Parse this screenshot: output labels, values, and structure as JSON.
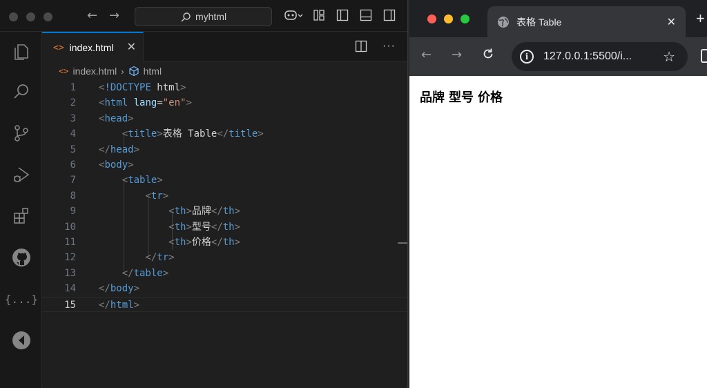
{
  "vscode": {
    "command_center": "myhtml",
    "tab": {
      "label": "index.html",
      "icon": "html-file-icon"
    },
    "breadcrumb": {
      "file": "index.html",
      "element": "html"
    },
    "current_line": 15,
    "lines": [
      {
        "num": "1",
        "tokens": [
          {
            "t": "br",
            "v": "<"
          },
          {
            "t": "tag",
            "v": "!DOCTYPE"
          },
          {
            "t": "txt",
            "v": " html"
          },
          {
            "t": "br",
            "v": ">"
          }
        ]
      },
      {
        "num": "2",
        "tokens": [
          {
            "t": "br",
            "v": "<"
          },
          {
            "t": "tag",
            "v": "html"
          },
          {
            "t": "txt",
            "v": " "
          },
          {
            "t": "attr",
            "v": "lang"
          },
          {
            "t": "txt",
            "v": "="
          },
          {
            "t": "str",
            "v": "\"en\""
          },
          {
            "t": "br",
            "v": ">"
          }
        ]
      },
      {
        "num": "3",
        "tokens": [
          {
            "t": "br",
            "v": "<"
          },
          {
            "t": "tag",
            "v": "head"
          },
          {
            "t": "br",
            "v": ">"
          }
        ]
      },
      {
        "num": "4",
        "tokens": [
          {
            "t": "txt",
            "v": "    "
          },
          {
            "t": "br",
            "v": "<"
          },
          {
            "t": "tag",
            "v": "title"
          },
          {
            "t": "br",
            "v": ">"
          },
          {
            "t": "txt",
            "v": "表格 Table"
          },
          {
            "t": "br",
            "v": "</"
          },
          {
            "t": "tag",
            "v": "title"
          },
          {
            "t": "br",
            "v": ">"
          }
        ]
      },
      {
        "num": "5",
        "tokens": [
          {
            "t": "br",
            "v": "</"
          },
          {
            "t": "tag",
            "v": "head"
          },
          {
            "t": "br",
            "v": ">"
          }
        ]
      },
      {
        "num": "6",
        "tokens": [
          {
            "t": "br",
            "v": "<"
          },
          {
            "t": "tag",
            "v": "body"
          },
          {
            "t": "br",
            "v": ">"
          }
        ]
      },
      {
        "num": "7",
        "tokens": [
          {
            "t": "txt",
            "v": "    "
          },
          {
            "t": "br",
            "v": "<"
          },
          {
            "t": "tag",
            "v": "table"
          },
          {
            "t": "br",
            "v": ">"
          }
        ]
      },
      {
        "num": "8",
        "tokens": [
          {
            "t": "txt",
            "v": "        "
          },
          {
            "t": "br",
            "v": "<"
          },
          {
            "t": "tag",
            "v": "tr"
          },
          {
            "t": "br",
            "v": ">"
          }
        ]
      },
      {
        "num": "9",
        "tokens": [
          {
            "t": "txt",
            "v": "            "
          },
          {
            "t": "br",
            "v": "<"
          },
          {
            "t": "tag",
            "v": "th"
          },
          {
            "t": "br",
            "v": ">"
          },
          {
            "t": "txt",
            "v": "品牌"
          },
          {
            "t": "br",
            "v": "</"
          },
          {
            "t": "tag",
            "v": "th"
          },
          {
            "t": "br",
            "v": ">"
          }
        ]
      },
      {
        "num": "10",
        "tokens": [
          {
            "t": "txt",
            "v": "            "
          },
          {
            "t": "br",
            "v": "<"
          },
          {
            "t": "tag",
            "v": "th"
          },
          {
            "t": "br",
            "v": ">"
          },
          {
            "t": "txt",
            "v": "型号"
          },
          {
            "t": "br",
            "v": "</"
          },
          {
            "t": "tag",
            "v": "th"
          },
          {
            "t": "br",
            "v": ">"
          }
        ]
      },
      {
        "num": "11",
        "tokens": [
          {
            "t": "txt",
            "v": "            "
          },
          {
            "t": "br",
            "v": "<"
          },
          {
            "t": "tag",
            "v": "th"
          },
          {
            "t": "br",
            "v": ">"
          },
          {
            "t": "txt",
            "v": "价格"
          },
          {
            "t": "br",
            "v": "</"
          },
          {
            "t": "tag",
            "v": "th"
          },
          {
            "t": "br",
            "v": ">"
          }
        ]
      },
      {
        "num": "12",
        "tokens": [
          {
            "t": "txt",
            "v": "        "
          },
          {
            "t": "br",
            "v": "</"
          },
          {
            "t": "tag",
            "v": "tr"
          },
          {
            "t": "br",
            "v": ">"
          }
        ]
      },
      {
        "num": "13",
        "tokens": [
          {
            "t": "txt",
            "v": "    "
          },
          {
            "t": "br",
            "v": "</"
          },
          {
            "t": "tag",
            "v": "table"
          },
          {
            "t": "br",
            "v": ">"
          }
        ]
      },
      {
        "num": "14",
        "tokens": [
          {
            "t": "br",
            "v": "</"
          },
          {
            "t": "tag",
            "v": "body"
          },
          {
            "t": "br",
            "v": ">"
          }
        ]
      },
      {
        "num": "15",
        "tokens": [
          {
            "t": "br",
            "v": "</"
          },
          {
            "t": "tag",
            "v": "html"
          },
          {
            "t": "br",
            "v": ">"
          }
        ]
      }
    ],
    "activity_icons": [
      "explorer-icon",
      "search-icon",
      "source-control-icon",
      "run-debug-icon",
      "extensions-icon",
      "github-icon",
      "json-icon",
      "live-share-icon"
    ],
    "colors": {
      "accent": "#0078d4",
      "tag": "#569cd6",
      "attr": "#9cdcfe",
      "string": "#ce9178"
    }
  },
  "browser": {
    "tab_title": "表格 Table",
    "url": "127.0.0.1:5500/i...",
    "table_headers": [
      "品牌",
      "型号",
      "价格"
    ]
  }
}
